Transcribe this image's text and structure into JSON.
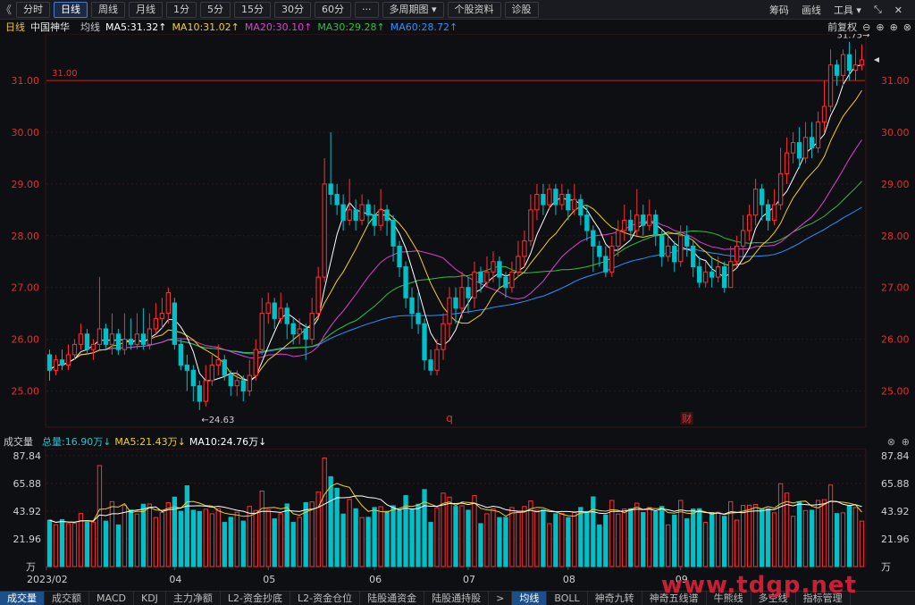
{
  "toolbar": {
    "back_glyph": "《",
    "tabs": [
      "分时",
      "日线",
      "周线",
      "月线",
      "1分",
      "5分",
      "15分",
      "30分",
      "60分",
      "···",
      "多周期图 ▾",
      "个股资料",
      "诊股"
    ],
    "active_tab": "日线",
    "right": [
      "筹码",
      "画线",
      "工具 ▾",
      "⤡",
      "✕"
    ]
  },
  "legend": {
    "period": "日线",
    "name": "中国神华",
    "ma_label": "均线",
    "ma5": "MA5:31.32↑",
    "ma10": "MA10:31.02↑",
    "ma20": "MA20:30.10↑",
    "ma30": "MA30:29.28↑",
    "ma60": "MA60:28.72↑",
    "adjust": "前复权",
    "ctrl_icons": [
      "⊖",
      "⊕",
      "⊕",
      "⊗"
    ]
  },
  "colors": {
    "up": "#ff3030",
    "down": "#00c0c8",
    "ma5": "#ffffff",
    "ma10": "#f0d020",
    "ma20": "#e040d0",
    "ma30": "#30c040",
    "ma60": "#3090ff",
    "grid": "#3a1416",
    "axis_text": "#e03030"
  },
  "chart_data": {
    "type": "candlestick",
    "y_ticks": [
      "31.00",
      "30.00",
      "29.00",
      "28.00",
      "27.00",
      "26.00",
      "25.00"
    ],
    "ylim": [
      24.3,
      31.9
    ],
    "ref_line": {
      "value": 31.0,
      "label": "31.00"
    },
    "high_label": "31.75→",
    "low_label": "←24.63",
    "markers": [
      "q",
      "财"
    ],
    "month_labels": [
      "2023/02",
      "04",
      "05",
      "06",
      "07",
      "08",
      "09"
    ],
    "candles": [
      [
        25.7,
        25.4,
        25.8,
        25.2
      ],
      [
        25.4,
        25.6,
        25.7,
        25.3
      ],
      [
        25.6,
        25.5,
        25.8,
        25.4
      ],
      [
        25.5,
        25.7,
        25.9,
        25.4
      ],
      [
        25.7,
        25.9,
        26.0,
        25.6
      ],
      [
        25.9,
        26.1,
        26.3,
        25.8
      ],
      [
        26.1,
        25.8,
        26.2,
        25.7
      ],
      [
        25.8,
        25.9,
        26.0,
        25.6
      ],
      [
        25.9,
        26.2,
        27.2,
        25.8
      ],
      [
        26.2,
        25.9,
        26.3,
        25.8
      ],
      [
        25.9,
        26.1,
        26.5,
        25.7
      ],
      [
        26.1,
        25.8,
        26.2,
        25.7
      ],
      [
        25.8,
        26.0,
        26.5,
        25.7
      ],
      [
        26.0,
        25.9,
        26.4,
        25.8
      ],
      [
        25.9,
        26.1,
        26.5,
        25.8
      ],
      [
        26.1,
        25.9,
        26.6,
        25.8
      ],
      [
        25.9,
        26.2,
        26.5,
        25.8
      ],
      [
        26.2,
        26.4,
        26.7,
        26.1
      ],
      [
        26.4,
        26.5,
        26.8,
        26.2
      ],
      [
        26.5,
        26.9,
        27.0,
        26.3
      ],
      [
        26.7,
        25.9,
        26.8,
        25.8
      ],
      [
        25.9,
        25.5,
        26.0,
        25.4
      ],
      [
        25.5,
        25.4,
        25.7,
        25.0
      ],
      [
        25.4,
        25.1,
        25.5,
        24.8
      ],
      [
        25.1,
        24.8,
        25.2,
        24.63
      ],
      [
        24.8,
        25.2,
        25.5,
        24.7
      ],
      [
        25.2,
        25.5,
        25.7,
        25.1
      ],
      [
        25.5,
        25.6,
        25.9,
        25.3
      ],
      [
        25.6,
        25.3,
        25.7,
        25.2
      ],
      [
        25.3,
        25.1,
        25.4,
        24.9
      ],
      [
        25.1,
        25.2,
        25.4,
        24.9
      ],
      [
        25.2,
        25.0,
        25.3,
        24.8
      ],
      [
        25.0,
        25.3,
        25.6,
        24.9
      ],
      [
        25.3,
        25.8,
        26.0,
        25.2
      ],
      [
        25.8,
        26.5,
        26.8,
        25.7
      ],
      [
        26.5,
        26.7,
        26.9,
        26.3
      ],
      [
        26.7,
        26.4,
        26.8,
        26.2
      ],
      [
        26.4,
        26.6,
        26.9,
        26.3
      ],
      [
        26.6,
        26.3,
        26.7,
        26.0
      ],
      [
        26.3,
        26.1,
        26.4,
        25.9
      ],
      [
        26.1,
        26.2,
        26.4,
        25.9
      ],
      [
        26.2,
        26.0,
        26.3,
        25.6
      ],
      [
        26.0,
        26.5,
        26.8,
        25.9
      ],
      [
        26.5,
        27.2,
        27.4,
        26.4
      ],
      [
        27.2,
        29.0,
        29.5,
        27.1
      ],
      [
        29.0,
        28.8,
        30.0,
        28.6
      ],
      [
        28.8,
        28.6,
        29.0,
        28.4
      ],
      [
        28.6,
        28.3,
        28.8,
        28.1
      ],
      [
        28.3,
        28.5,
        29.1,
        28.2
      ],
      [
        28.5,
        28.3,
        28.7,
        28.1
      ],
      [
        28.3,
        28.6,
        28.8,
        28.2
      ],
      [
        28.6,
        28.4,
        28.7,
        28.2
      ],
      [
        28.4,
        28.2,
        28.6,
        28.0
      ],
      [
        28.2,
        28.5,
        28.9,
        28.1
      ],
      [
        28.5,
        28.3,
        28.6,
        28.0
      ],
      [
        28.3,
        27.8,
        28.4,
        27.5
      ],
      [
        27.8,
        27.4,
        27.9,
        27.2
      ],
      [
        27.4,
        26.8,
        27.5,
        26.6
      ],
      [
        26.8,
        26.5,
        27.0,
        26.2
      ],
      [
        26.5,
        26.3,
        26.9,
        26.1
      ],
      [
        26.3,
        25.6,
        26.4,
        25.4
      ],
      [
        25.6,
        25.4,
        25.8,
        25.3
      ],
      [
        25.4,
        25.8,
        26.0,
        25.3
      ],
      [
        25.8,
        26.3,
        26.5,
        25.6
      ],
      [
        26.3,
        26.8,
        27.0,
        26.0
      ],
      [
        26.8,
        26.6,
        27.0,
        26.3
      ],
      [
        26.6,
        27.0,
        27.3,
        26.4
      ],
      [
        27.0,
        26.8,
        27.2,
        26.5
      ],
      [
        26.8,
        27.3,
        27.5,
        26.6
      ],
      [
        27.3,
        27.1,
        27.4,
        26.9
      ],
      [
        27.1,
        27.3,
        27.6,
        27.0
      ],
      [
        27.3,
        27.5,
        27.7,
        27.1
      ],
      [
        27.5,
        27.2,
        27.6,
        27.0
      ],
      [
        27.2,
        27.0,
        27.3,
        26.8
      ],
      [
        27.0,
        27.3,
        27.5,
        26.9
      ],
      [
        27.3,
        27.6,
        27.9,
        27.2
      ],
      [
        27.6,
        27.9,
        28.1,
        27.4
      ],
      [
        27.9,
        28.5,
        28.8,
        27.8
      ],
      [
        28.5,
        28.8,
        29.0,
        28.3
      ],
      [
        28.8,
        28.6,
        29.0,
        28.4
      ],
      [
        28.6,
        28.9,
        29.0,
        28.5
      ],
      [
        28.9,
        28.6,
        29.0,
        28.4
      ],
      [
        28.6,
        28.8,
        29.0,
        28.5
      ],
      [
        28.8,
        28.5,
        28.9,
        28.3
      ],
      [
        28.5,
        28.7,
        29.0,
        28.4
      ],
      [
        28.7,
        28.4,
        28.8,
        28.2
      ],
      [
        28.4,
        28.1,
        28.6,
        27.9
      ],
      [
        28.1,
        27.8,
        28.2,
        27.3
      ],
      [
        27.8,
        27.6,
        27.9,
        27.4
      ],
      [
        27.6,
        27.3,
        27.8,
        27.2
      ],
      [
        27.3,
        27.8,
        28.0,
        27.2
      ],
      [
        27.8,
        28.1,
        28.3,
        27.6
      ],
      [
        28.1,
        28.3,
        28.6,
        27.9
      ],
      [
        28.3,
        28.1,
        28.5,
        27.9
      ],
      [
        28.1,
        28.4,
        28.9,
        28.0
      ],
      [
        28.4,
        28.2,
        28.6,
        28.0
      ],
      [
        28.2,
        28.4,
        28.7,
        28.1
      ],
      [
        28.4,
        28.0,
        28.5,
        27.8
      ],
      [
        28.0,
        27.6,
        28.1,
        27.4
      ],
      [
        27.6,
        27.8,
        28.0,
        27.5
      ],
      [
        27.8,
        27.5,
        27.9,
        27.3
      ],
      [
        27.5,
        28.0,
        28.2,
        27.4
      ],
      [
        28.0,
        27.8,
        28.2,
        27.6
      ],
      [
        27.8,
        27.4,
        27.9,
        27.2
      ],
      [
        27.4,
        27.1,
        27.6,
        27.0
      ],
      [
        27.1,
        27.3,
        27.5,
        27.0
      ],
      [
        27.3,
        27.2,
        27.6,
        27.0
      ],
      [
        27.2,
        27.4,
        27.6,
        27.1
      ],
      [
        27.4,
        27.0,
        27.5,
        26.9
      ],
      [
        27.0,
        27.5,
        27.8,
        27.0
      ],
      [
        27.5,
        27.8,
        28.0,
        27.4
      ],
      [
        27.8,
        28.1,
        28.4,
        27.6
      ],
      [
        28.1,
        28.4,
        28.6,
        27.9
      ],
      [
        28.4,
        28.9,
        29.1,
        28.2
      ],
      [
        28.9,
        28.6,
        29.0,
        28.3
      ],
      [
        28.6,
        28.3,
        28.7,
        28.1
      ],
      [
        28.3,
        28.6,
        28.9,
        28.2
      ],
      [
        28.6,
        29.2,
        29.7,
        28.5
      ],
      [
        29.2,
        29.6,
        29.9,
        29.0
      ],
      [
        29.6,
        29.8,
        30.0,
        29.4
      ],
      [
        29.8,
        29.5,
        30.1,
        29.3
      ],
      [
        29.5,
        29.9,
        30.2,
        29.4
      ],
      [
        29.9,
        29.7,
        30.2,
        29.5
      ],
      [
        29.7,
        30.2,
        30.4,
        29.6
      ],
      [
        30.2,
        30.5,
        31.0,
        30.0
      ],
      [
        30.5,
        31.3,
        31.6,
        30.4
      ],
      [
        31.3,
        31.1,
        31.4,
        30.9
      ],
      [
        31.1,
        31.5,
        31.6,
        30.9
      ],
      [
        31.5,
        31.2,
        31.75,
        31.0
      ],
      [
        31.2,
        31.3,
        31.6,
        31.0
      ],
      [
        31.3,
        31.4,
        31.7,
        31.2
      ]
    ],
    "volume": {
      "y_ticks": [
        "87.84",
        "65.88",
        "43.92",
        "21.96",
        "万"
      ],
      "ylim": [
        0,
        92
      ],
      "total": "总量:16.90万↓",
      "ma5": "MA5:21.43万↓",
      "ma10": "MA10:24.76万↓",
      "label": "成交量"
    }
  },
  "bottom_tabs": [
    "成交量",
    "成交额",
    "MACD",
    "KDJ",
    "主力净额",
    "L2-资金抄底",
    "L2-资金仓位",
    "陆股通资金",
    "陆股通持股",
    ">",
    "均线",
    "BOLL",
    "神奇九转",
    "神奇五线谱",
    "牛熊线",
    "多空线",
    "指标管理"
  ],
  "watermark": "www.tdgp.net"
}
